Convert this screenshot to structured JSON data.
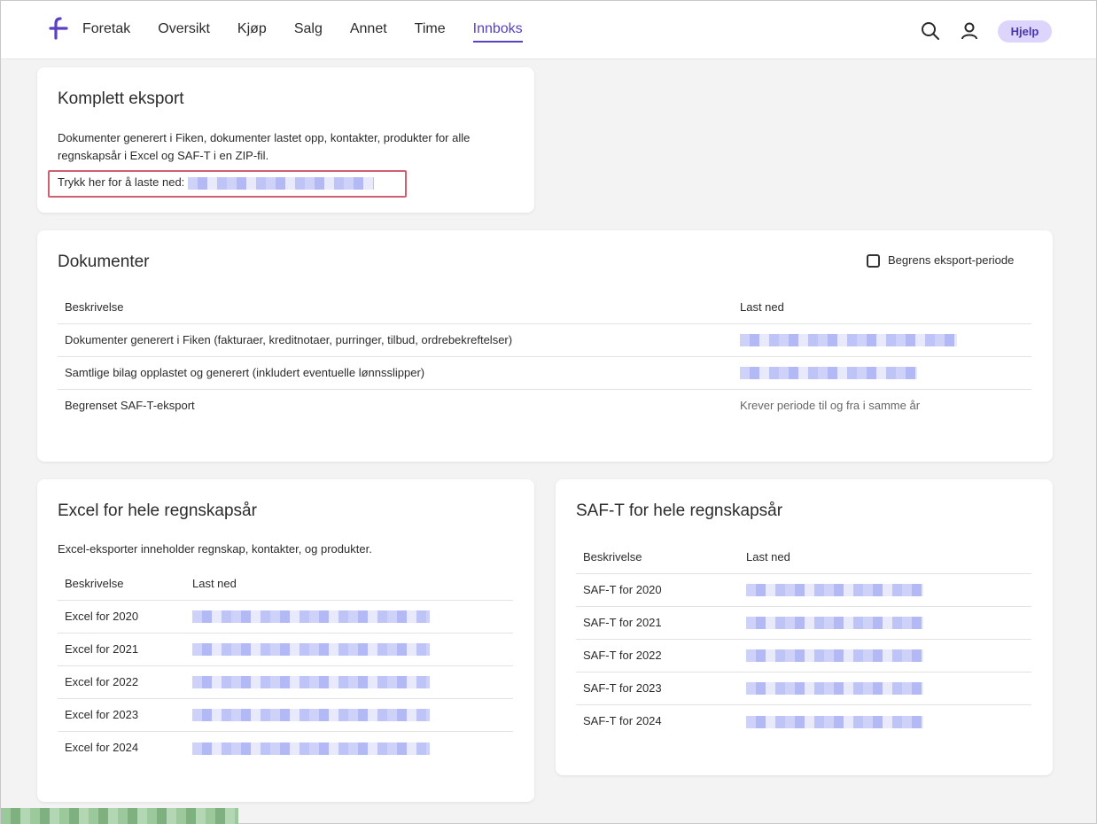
{
  "header": {
    "nav": [
      "Foretak",
      "Oversikt",
      "Kjøp",
      "Salg",
      "Annet",
      "Time",
      "Innboks"
    ],
    "active_nav": "Innboks",
    "help_label": "Hjelp",
    "icons": [
      "search-icon",
      "user-icon"
    ]
  },
  "complete_export": {
    "title": "Komplett eksport",
    "description": "Dokumenter generert i Fiken, dokumenter lastet opp, kontakter, produkter for alle regnskapsår i Excel og SAF-T i en ZIP-fil.",
    "download_label": "Trykk her for å laste ned:"
  },
  "documents": {
    "title": "Dokumenter",
    "limit_period_label": "Begrens eksport-periode",
    "columns": [
      "Beskrivelse",
      "Last ned"
    ],
    "rows": [
      {
        "description": "Dokumenter generert i Fiken (fakturaer, kreditnotaer, purringer, tilbud, ordrebekreftelser)",
        "download": ""
      },
      {
        "description": "Samtlige bilag opplastet og generert (inkludert eventuelle lønnsslipper)",
        "download": ""
      },
      {
        "description": "Begrenset SAF-T-eksport",
        "download": "Krever periode til og fra i samme år"
      }
    ]
  },
  "excel": {
    "title": "Excel for hele regnskapsår",
    "description": "Excel-eksporter inneholder regnskap, kontakter, og produkter.",
    "columns": [
      "Beskrivelse",
      "Last ned"
    ],
    "rows": [
      "Excel for 2020",
      "Excel for 2021",
      "Excel for 2022",
      "Excel for 2023",
      "Excel for 2024"
    ]
  },
  "saft": {
    "title": "SAF-T for hele regnskapsår",
    "columns": [
      "Beskrivelse",
      "Last ned"
    ],
    "rows": [
      "SAF-T for 2020",
      "SAF-T for 2021",
      "SAF-T for 2022",
      "SAF-T for 2023",
      "SAF-T for 2024"
    ]
  },
  "colors": {
    "accent": "#5b3fc4",
    "help_bg": "#ddd5fb",
    "highlight": "#d06070"
  }
}
